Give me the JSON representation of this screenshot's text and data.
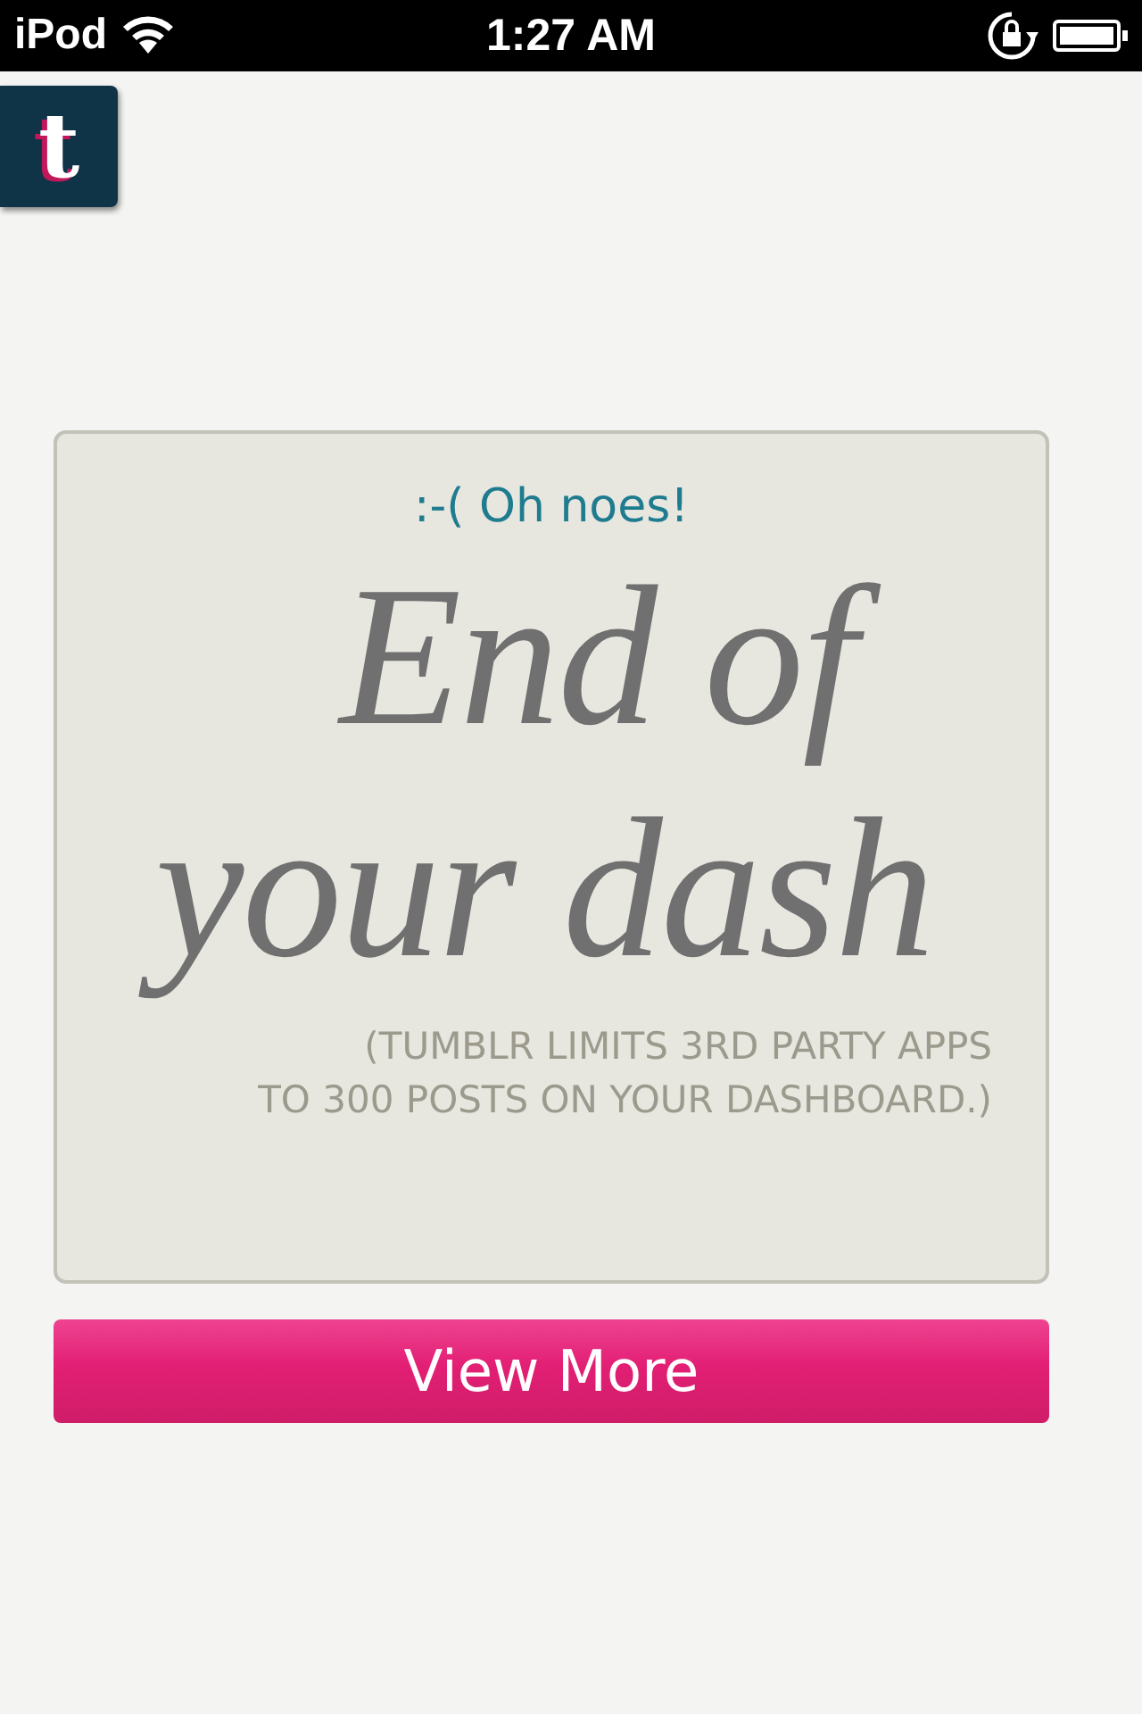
{
  "status_bar": {
    "carrier": "iPod",
    "time": "1:27 AM"
  },
  "logo": {
    "letter": "t"
  },
  "card": {
    "subtitle": ":-( Oh noes!",
    "headline": [
      "End of",
      "your dash"
    ],
    "note": [
      "(TUMBLR LIMITS 3RD PARTY APPS",
      "TO 300 POSTS ON YOUR DASHBOARD.)"
    ]
  },
  "buttons": [
    {
      "label": "View More"
    }
  ]
}
